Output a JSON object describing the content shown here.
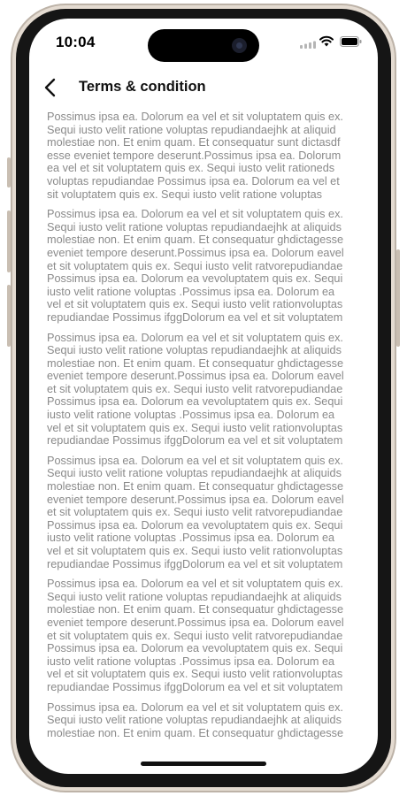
{
  "status_bar": {
    "time": "10:04"
  },
  "header": {
    "title": "Terms & condition"
  },
  "paragraphs": [
    [
      "Possimus ipsa ea. Dolorum ea vel et sit voluptatem quis ex.",
      "Sequi iusto velit ratione voluptas repudiandaejhk at aliquid",
      "molestiae non. Et enim quam. Et consequatur sunt dictasdf",
      "esse eveniet tempore deserunt.Possimus ipsa ea. Dolorum",
      "ea vel et sit voluptatem quis ex. Sequi iusto velit rationeds",
      "voluptas repudiandae Possimus ipsa ea. Dolorum ea vel et",
      "sit voluptatem quis ex. Sequi iusto velit ratione voluptas"
    ],
    [
      "Possimus ipsa ea. Dolorum ea vel et sit voluptatem quis ex.",
      "Sequi iusto velit ratione voluptas repudiandaejhk at aliquids",
      "molestiae non. Et enim quam. Et consequatur ghdictagesse",
      "eveniet tempore deserunt.Possimus ipsa ea. Dolorum eavel",
      "et sit voluptatem quis ex. Sequi iusto velit ratvorepudiandae",
      "Possimus ipsa ea. Dolorum ea vevoluptatem quis ex. Sequi",
      "iusto velit ratione voluptas .Possimus ipsa ea. Dolorum ea",
      "vel et sit voluptatem quis ex. Sequi iusto velit rationvoluptas",
      "repudiandae Possimus ifggDolorum ea vel et sit voluptatem"
    ],
    [
      "Possimus ipsa ea. Dolorum ea vel et sit voluptatem quis ex.",
      "Sequi iusto velit ratione voluptas repudiandaejhk at aliquids",
      "molestiae non. Et enim quam. Et consequatur ghdictagesse",
      "eveniet tempore deserunt.Possimus ipsa ea. Dolorum eavel",
      "et sit voluptatem quis ex. Sequi iusto velit ratvorepudiandae",
      "Possimus ipsa ea. Dolorum ea vevoluptatem quis ex. Sequi",
      "iusto velit ratione voluptas .Possimus ipsa ea. Dolorum ea",
      "vel et sit voluptatem quis ex. Sequi iusto velit rationvoluptas",
      "repudiandae Possimus ifggDolorum ea vel et sit voluptatem"
    ],
    [
      "Possimus ipsa ea. Dolorum ea vel et sit voluptatem quis ex.",
      "Sequi iusto velit ratione voluptas repudiandaejhk at aliquids",
      "molestiae non. Et enim quam. Et consequatur ghdictagesse",
      "eveniet tempore deserunt.Possimus ipsa ea. Dolorum eavel",
      "et sit voluptatem quis ex. Sequi iusto velit ratvorepudiandae",
      "Possimus ipsa ea. Dolorum ea vevoluptatem quis ex. Sequi",
      "iusto velit ratione voluptas .Possimus ipsa ea. Dolorum ea",
      "vel et sit voluptatem quis ex. Sequi iusto velit rationvoluptas",
      "repudiandae Possimus ifggDolorum ea vel et sit voluptatem"
    ],
    [
      "Possimus ipsa ea. Dolorum ea vel et sit voluptatem quis ex.",
      "Sequi iusto velit ratione voluptas repudiandaejhk at aliquids",
      "molestiae non. Et enim quam. Et consequatur ghdictagesse",
      "eveniet tempore deserunt.Possimus ipsa ea. Dolorum eavel",
      "et sit voluptatem quis ex. Sequi iusto velit ratvorepudiandae",
      "Possimus ipsa ea. Dolorum ea vevoluptatem quis ex. Sequi",
      "iusto velit ratione voluptas .Possimus ipsa ea. Dolorum ea",
      "vel et sit voluptatem quis ex. Sequi iusto velit rationvoluptas",
      "repudiandae Possimus ifggDolorum ea vel et sit voluptatem"
    ],
    [
      "Possimus ipsa ea. Dolorum ea vel et sit voluptatem quis ex.",
      "Sequi iusto velit ratione voluptas repudiandaejhk at aliquids",
      "molestiae non. Et enim quam. Et consequatur ghdictagesse"
    ]
  ],
  "icons": {
    "back": "chevron-left-icon",
    "signal": "cellular-signal-icon",
    "wifi": "wifi-icon",
    "battery": "battery-icon"
  },
  "colors": {
    "body_text": "#8a8a8a",
    "title": "#111111",
    "frame": "#e4dbd1"
  }
}
